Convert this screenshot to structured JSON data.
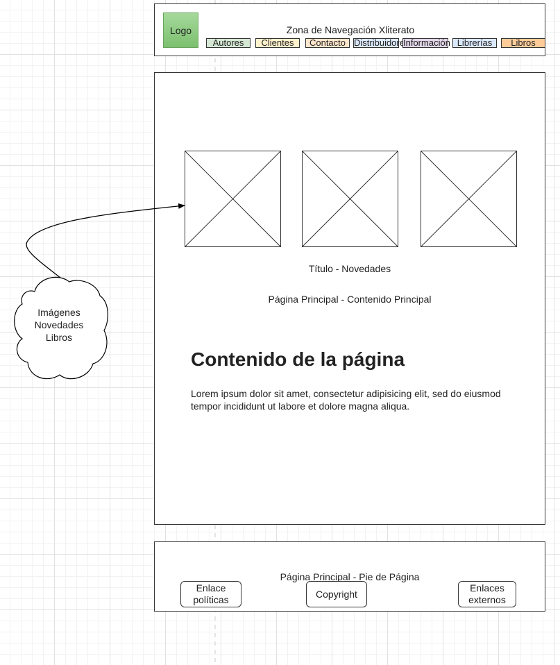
{
  "header": {
    "logo_label": "Logo",
    "title": "Zona de Navegación Xliterato",
    "nav": [
      {
        "label": "Autores",
        "color": "#d5e8d4"
      },
      {
        "label": "Clientes",
        "color": "#fff2cc"
      },
      {
        "label": "Contacto",
        "color": "#ffe6cc"
      },
      {
        "label": "Distribuidores",
        "color": "#dae8fc"
      },
      {
        "label": "Información",
        "color": "#e1d5e7"
      },
      {
        "label": "Librerías",
        "color": "#dae8fc"
      },
      {
        "label": "Libros",
        "color": "#ffcc99"
      }
    ],
    "logo_color": "#97d077"
  },
  "main": {
    "images_title": "Título - Novedades",
    "section_label": "Página Principal - Contenido Principal",
    "heading": "Contenido de la página",
    "paragraph": "Lorem ipsum dolor sit amet, consectetur adipisicing elit, sed do eiusmod tempor incididunt ut labore et dolore magna aliqua."
  },
  "annotation": {
    "cloud_text": "Imágenes Novedades Libros"
  },
  "footer": {
    "label": "Página Principal - Pie de Página",
    "left_button": "Enlace políticas",
    "center_button": "Copyright",
    "right_button": "Enlaces externos"
  }
}
